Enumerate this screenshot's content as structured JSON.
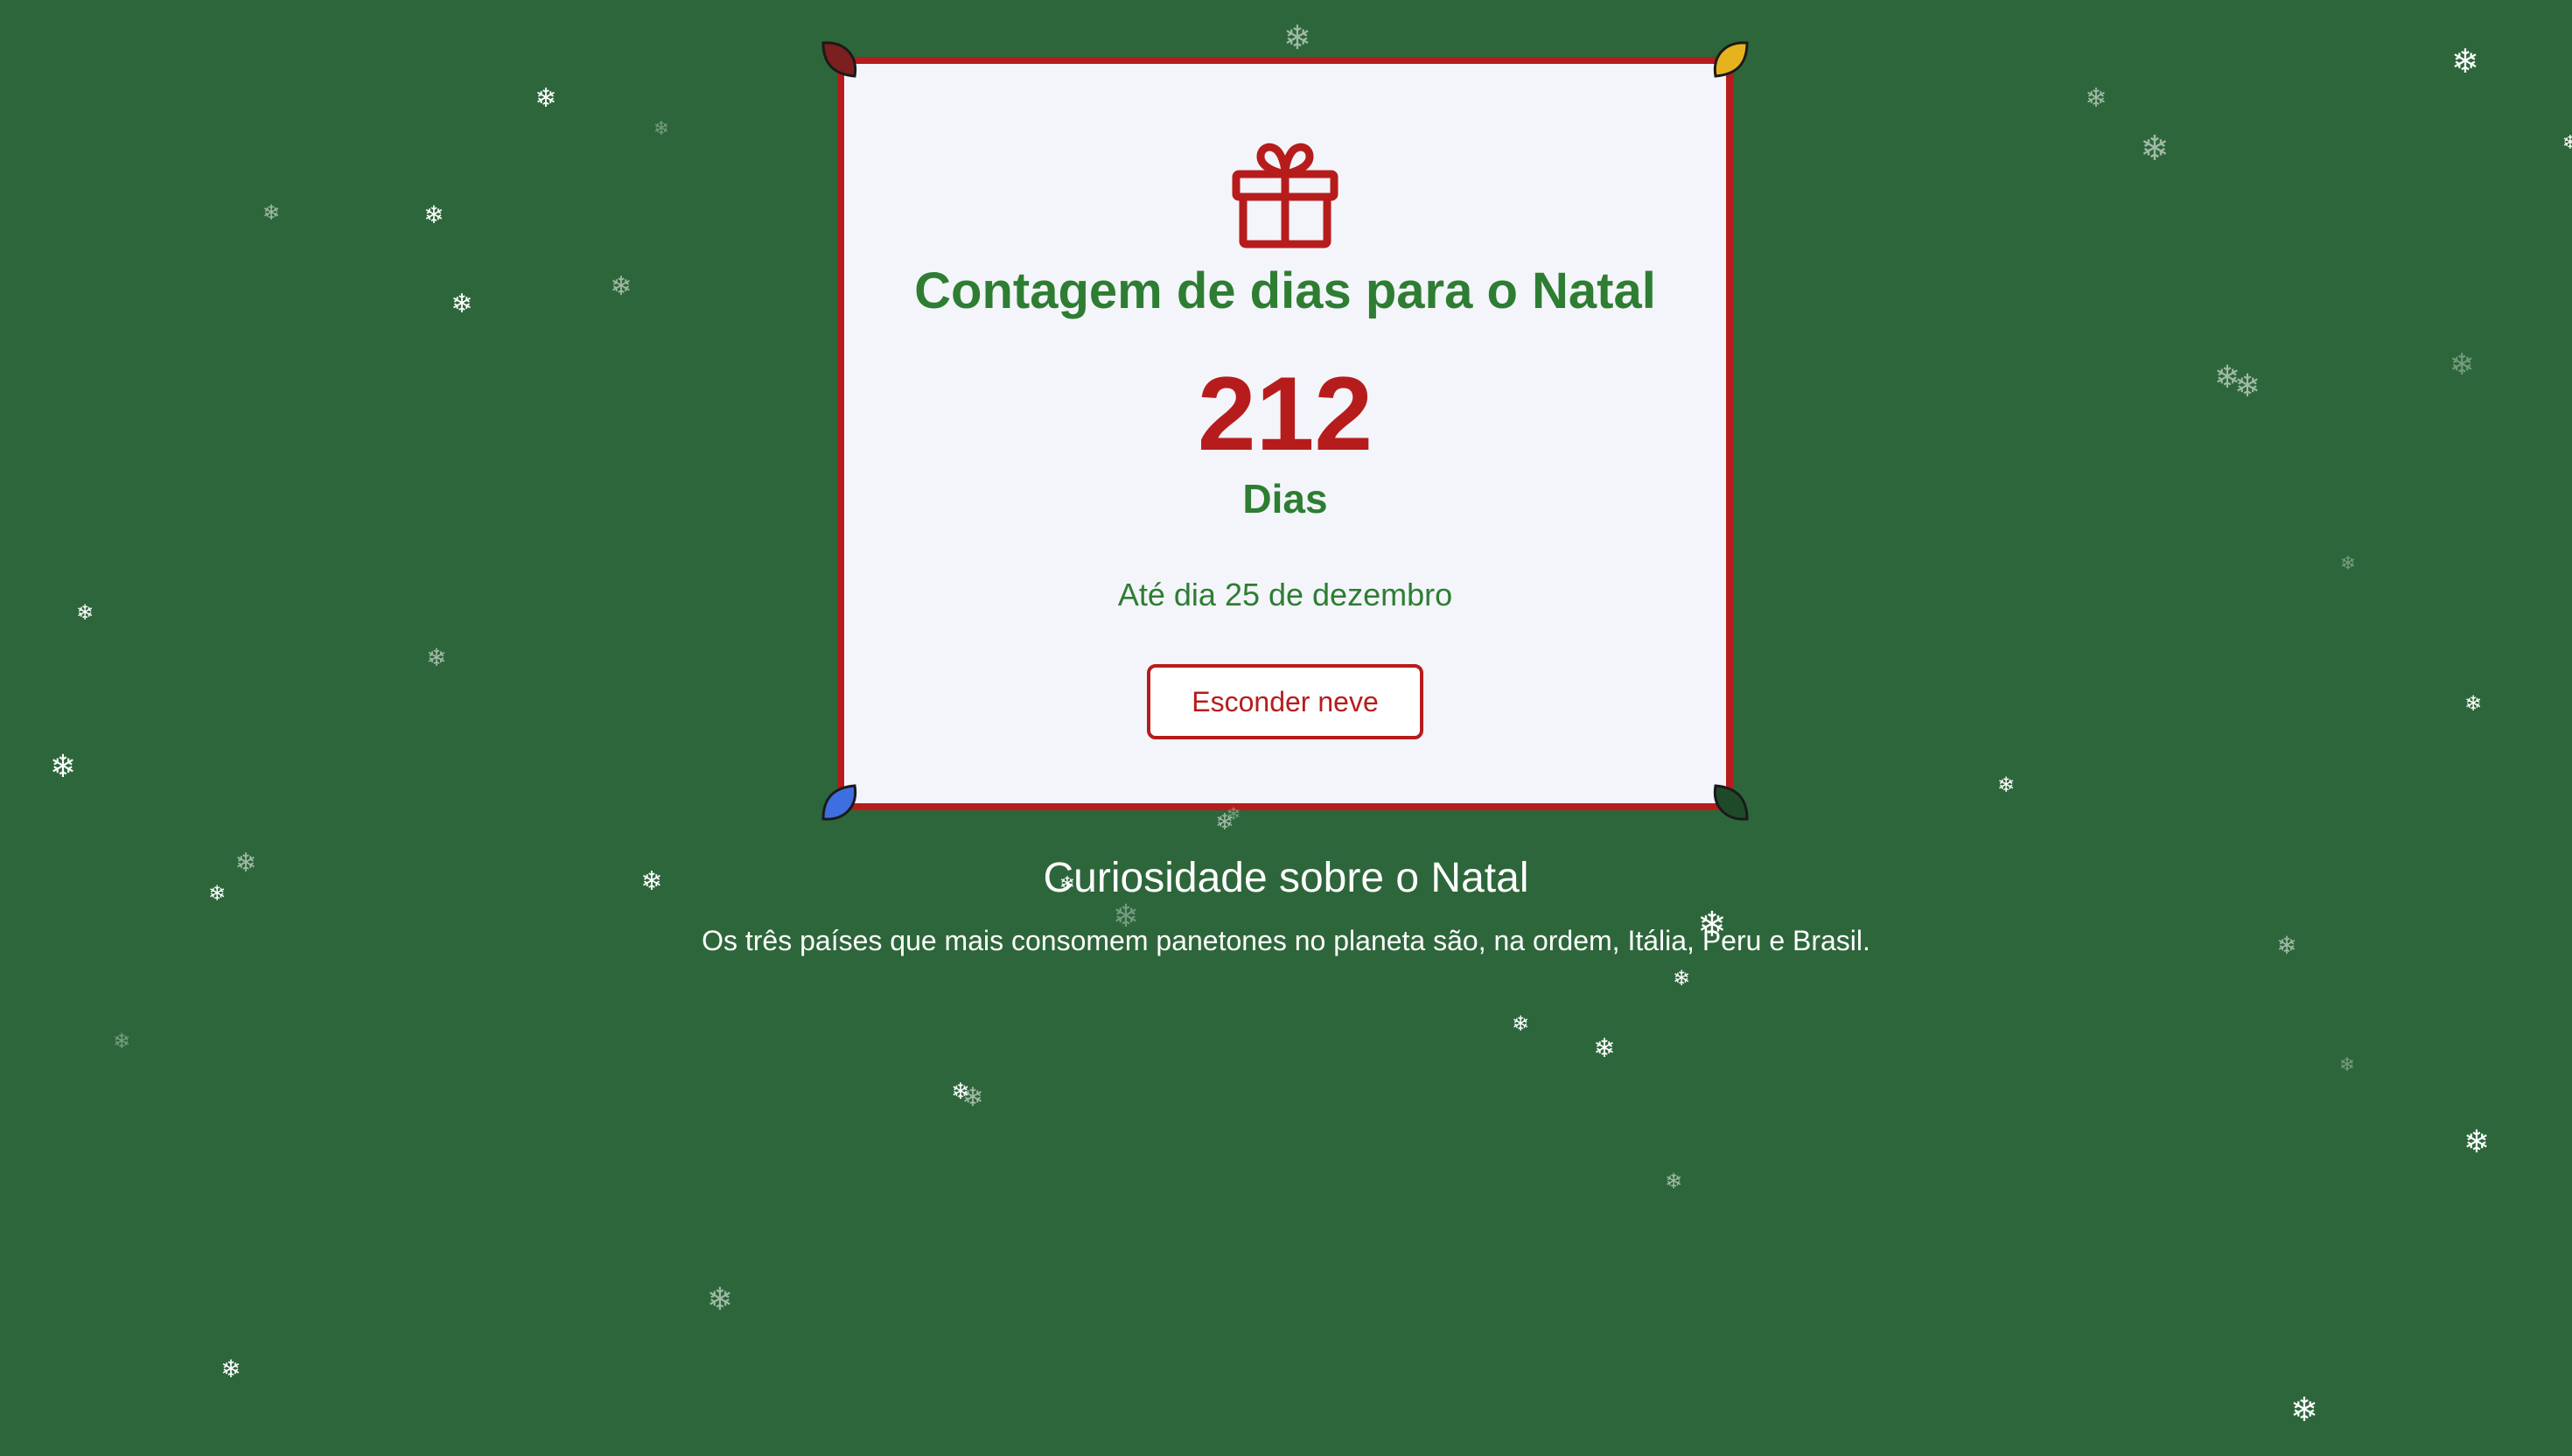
{
  "colors": {
    "background": "#2d663a",
    "card": "#f3f5fa",
    "accent_red": "#b71c1c",
    "accent_green": "#2e7d32",
    "text_white": "#ffffff",
    "bulb_top_left": "#7b1f1f",
    "bulb_top_right": "#e6b31e",
    "bulb_bottom_left": "#3d6fe0",
    "bulb_bottom_right": "#1f4a2a"
  },
  "card": {
    "icon": "gift-icon",
    "title": "Contagem de dias para o Natal",
    "days_count": "212",
    "days_unit": "Dias",
    "until_text": "Até dia 25 de dezembro",
    "toggle_button_label": "Esconder neve"
  },
  "fact": {
    "title": "Curiosidade sobre o Natal",
    "text": "Os três países que mais consomem panetones no planeta são, na ordem, Itália, Peru e Brasil."
  },
  "decorations": {
    "bulb_icon": "christmas-light-bulb-icon",
    "snowflake_icon": "snowflake-icon"
  }
}
